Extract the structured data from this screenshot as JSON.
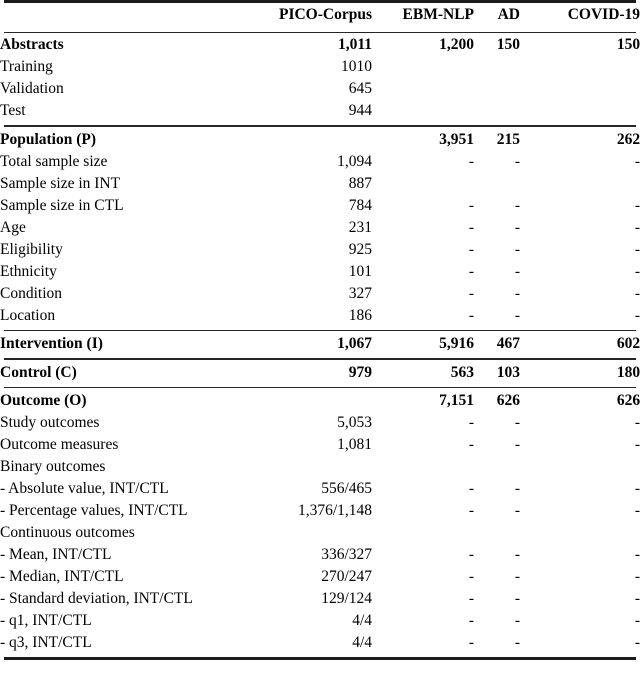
{
  "table": {
    "columns": [
      {
        "key": "label",
        "label": ""
      },
      {
        "key": "pico",
        "label": "PICO-Corpus"
      },
      {
        "key": "ebm",
        "label": "EBM-NLP"
      },
      {
        "key": "ad",
        "label": "AD"
      },
      {
        "key": "covid",
        "label": "COVID-19"
      }
    ],
    "sections": [
      {
        "name": "abstracts",
        "rows": [
          {
            "label": "Abstracts",
            "bold": true,
            "pico": "1,011",
            "ebm": "1,200",
            "ad": "150",
            "covid": "150"
          },
          {
            "label": "Training",
            "bold": false,
            "pico": "1010",
            "ebm": "",
            "ad": "",
            "covid": ""
          },
          {
            "label": "Validation",
            "bold": false,
            "pico": "645",
            "ebm": "",
            "ad": "",
            "covid": ""
          },
          {
            "label": "Test",
            "bold": false,
            "pico": "944",
            "ebm": "",
            "ad": "",
            "covid": ""
          }
        ]
      },
      {
        "name": "population",
        "rows": [
          {
            "label": "Population (P)",
            "bold": true,
            "pico": "",
            "ebm": "3,951",
            "ad": "215",
            "covid": "262"
          },
          {
            "label": "Total sample size",
            "bold": false,
            "pico": "1,094",
            "ebm": "-",
            "ad": "-",
            "covid": "-"
          },
          {
            "label": "Sample size in INT",
            "bold": false,
            "pico": "887",
            "ebm": "",
            "ad": "",
            "covid": ""
          },
          {
            "label": "Sample size in CTL",
            "bold": false,
            "pico": "784",
            "ebm": "-",
            "ad": "-",
            "covid": "-"
          },
          {
            "label": "Age",
            "bold": false,
            "pico": "231",
            "ebm": "-",
            "ad": "-",
            "covid": "-"
          },
          {
            "label": "Eligibility",
            "bold": false,
            "pico": "925",
            "ebm": "-",
            "ad": "-",
            "covid": "-"
          },
          {
            "label": "Ethnicity",
            "bold": false,
            "pico": "101",
            "ebm": "-",
            "ad": "-",
            "covid": "-"
          },
          {
            "label": "Condition",
            "bold": false,
            "pico": "327",
            "ebm": "-",
            "ad": "-",
            "covid": "-"
          },
          {
            "label": "Location",
            "bold": false,
            "pico": "186",
            "ebm": "-",
            "ad": "-",
            "covid": "-"
          }
        ]
      },
      {
        "name": "intervention",
        "rows": [
          {
            "label": "Intervention (I)",
            "bold": true,
            "pico": "1,067",
            "ebm": "5,916",
            "ad": "467",
            "covid": "602"
          }
        ]
      },
      {
        "name": "control",
        "rows": [
          {
            "label": "Control (C)",
            "bold": true,
            "pico": "979",
            "ebm": "563",
            "ad": "103",
            "covid": "180"
          }
        ]
      },
      {
        "name": "outcome",
        "rows": [
          {
            "label": "Outcome (O)",
            "bold": true,
            "pico": "",
            "ebm": "7,151",
            "ad": "626",
            "covid": "626"
          },
          {
            "label": "Study outcomes",
            "bold": false,
            "pico": "5,053",
            "ebm": "-",
            "ad": "-",
            "covid": "-"
          },
          {
            "label": "Outcome measures",
            "bold": false,
            "pico": "1,081",
            "ebm": "-",
            "ad": "-",
            "covid": "-"
          },
          {
            "label": "Binary outcomes",
            "bold": false,
            "pico": "",
            "ebm": "",
            "ad": "",
            "covid": ""
          },
          {
            "label": "- Absolute value, INT/CTL",
            "bold": false,
            "pico": "556/465",
            "ebm": "-",
            "ad": "-",
            "covid": "-"
          },
          {
            "label": "- Percentage values, INT/CTL",
            "bold": false,
            "pico": "1,376/1,148",
            "ebm": "-",
            "ad": "-",
            "covid": "-"
          },
          {
            "label": "Continuous outcomes",
            "bold": false,
            "pico": "",
            "ebm": "",
            "ad": "",
            "covid": ""
          },
          {
            "label": "- Mean, INT/CTL",
            "bold": false,
            "pico": "336/327",
            "ebm": "-",
            "ad": "-",
            "covid": "-"
          },
          {
            "label": "- Median, INT/CTL",
            "bold": false,
            "pico": "270/247",
            "ebm": "-",
            "ad": "-",
            "covid": "-"
          },
          {
            "label": "- Standard deviation, INT/CTL",
            "bold": false,
            "pico": "129/124",
            "ebm": "-",
            "ad": "-",
            "covid": "-"
          },
          {
            "label": "- q1, INT/CTL",
            "bold": false,
            "pico": "4/4",
            "ebm": "-",
            "ad": "-",
            "covid": "-"
          },
          {
            "label": "- q3, INT/CTL",
            "bold": false,
            "pico": "4/4",
            "ebm": "-",
            "ad": "-",
            "covid": "-"
          }
        ]
      }
    ]
  }
}
